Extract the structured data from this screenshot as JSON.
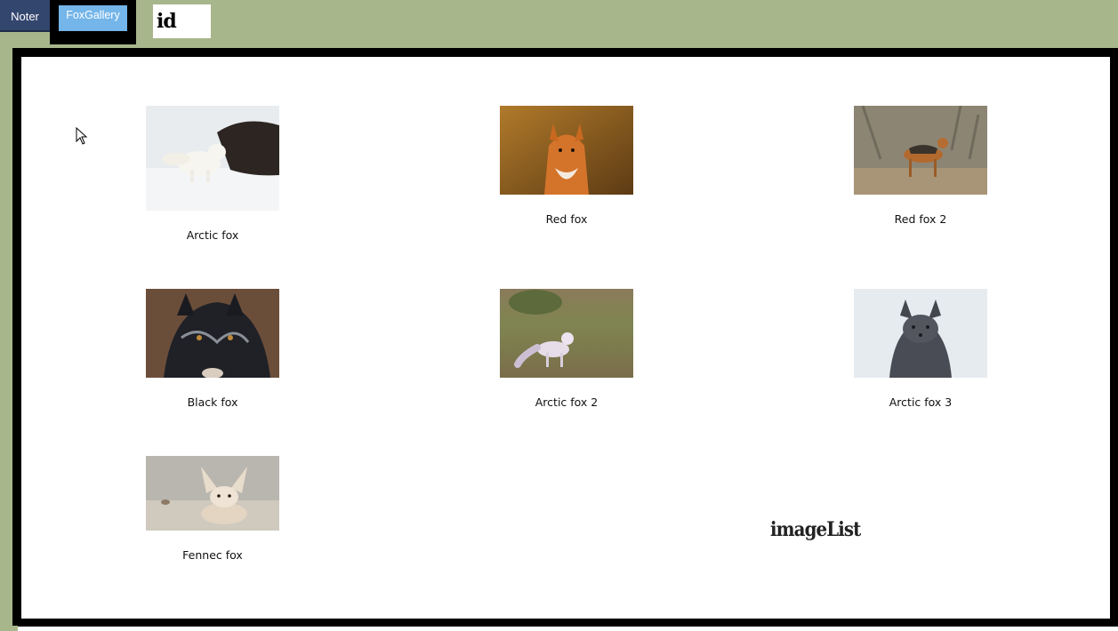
{
  "header": {
    "tabs": [
      {
        "label": "Noter"
      },
      {
        "label": "FoxGallery"
      }
    ],
    "id_field": {
      "value": "id"
    }
  },
  "gallery": {
    "items": [
      {
        "caption": "Arctic fox",
        "image": "arctic-fox-photo"
      },
      {
        "caption": "Red fox",
        "image": "red-fox-photo"
      },
      {
        "caption": "Red fox 2",
        "image": "red-fox-2-photo"
      },
      {
        "caption": "Black fox",
        "image": "black-fox-photo"
      },
      {
        "caption": "Arctic fox 2",
        "image": "arctic-fox-2-photo"
      },
      {
        "caption": "Arctic fox 3",
        "image": "arctic-fox-3-photo"
      },
      {
        "caption": "Fennec fox",
        "image": "fennec-fox-photo"
      }
    ],
    "list_label": "imageList"
  },
  "colors": {
    "background": "#a8b68c",
    "noter_tab": "#33466e",
    "gallery_tab": "#74b5ea",
    "panel_border": "#000000"
  }
}
